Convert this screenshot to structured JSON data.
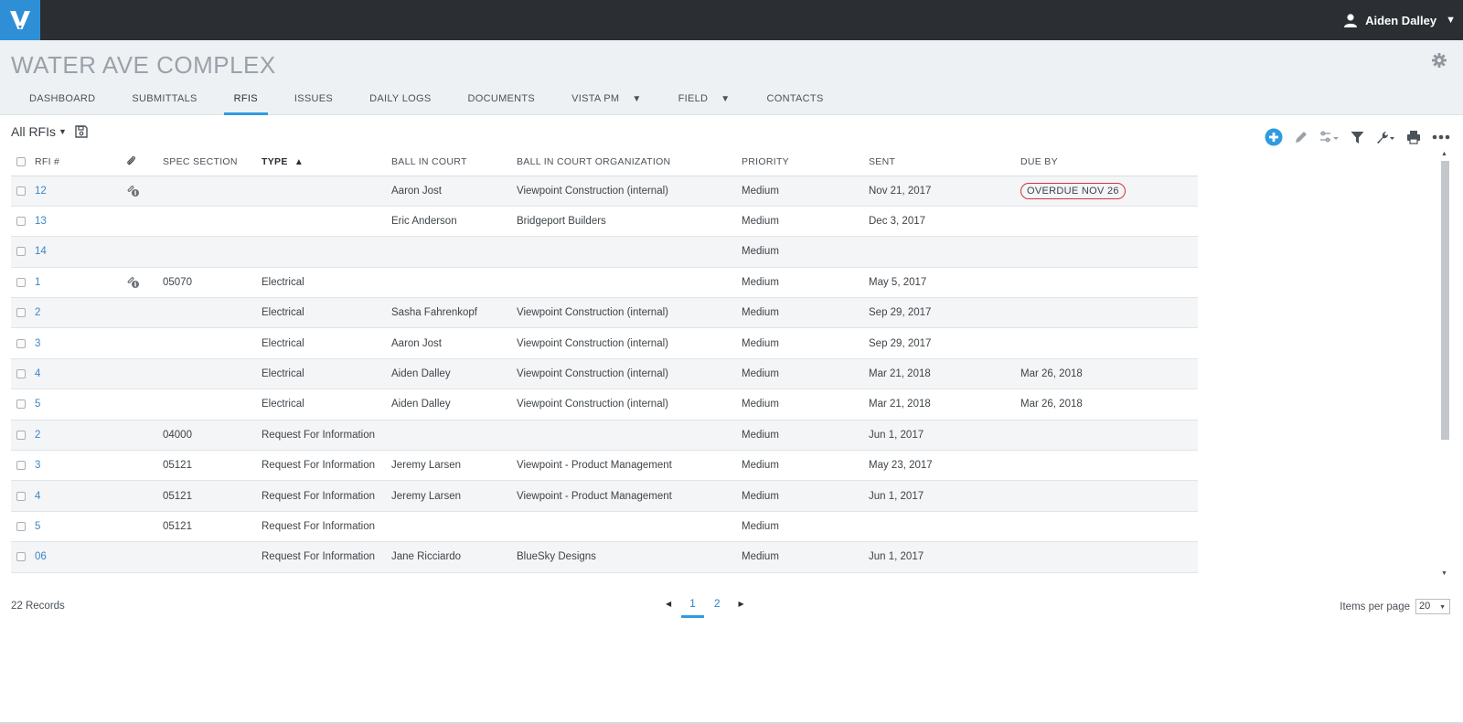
{
  "user": {
    "name": "Aiden Dalley"
  },
  "project": {
    "title": "WATER AVE COMPLEX"
  },
  "nav": [
    {
      "label": "DASHBOARD",
      "dropdown": false
    },
    {
      "label": "SUBMITTALS",
      "dropdown": false
    },
    {
      "label": "RFIS",
      "dropdown": false,
      "active": true
    },
    {
      "label": "ISSUES",
      "dropdown": false
    },
    {
      "label": "DAILY LOGS",
      "dropdown": false
    },
    {
      "label": "DOCUMENTS",
      "dropdown": false
    },
    {
      "label": "VISTA PM",
      "dropdown": true
    },
    {
      "label": "FIELD",
      "dropdown": true
    },
    {
      "label": "CONTACTS",
      "dropdown": false
    }
  ],
  "view": {
    "label": "All RFIs"
  },
  "colors": {
    "accent": "#2f9be0",
    "overdue": "#d9303b",
    "logo": "#2f8fd6"
  },
  "table": {
    "headers": {
      "rfi": "RFI #",
      "spec": "SPEC SECTION",
      "type": "TYPE",
      "bic": "BALL IN COURT",
      "bic_org": "BALL IN COURT ORGANIZATION",
      "priority": "PRIORITY",
      "sent": "SENT",
      "due": "DUE BY"
    },
    "sort_indicator": "▲",
    "rows": [
      {
        "rfi": "12",
        "attach": true,
        "spec": "",
        "type": "",
        "bic": "Aaron Jost",
        "bic_org": "Viewpoint Construction (internal)",
        "priority": "Medium",
        "sent": "Nov 21, 2017",
        "due": "OVERDUE NOV 26",
        "overdue": true
      },
      {
        "rfi": "13",
        "attach": false,
        "spec": "",
        "type": "",
        "bic": "Eric Anderson",
        "bic_org": "Bridgeport Builders",
        "priority": "Medium",
        "sent": "Dec 3, 2017",
        "due": ""
      },
      {
        "rfi": "14",
        "attach": false,
        "spec": "",
        "type": "",
        "bic": "",
        "bic_org": "",
        "priority": "Medium",
        "sent": "",
        "due": ""
      },
      {
        "rfi": "1",
        "attach": true,
        "spec": "05070",
        "type": "Electrical",
        "bic": "",
        "bic_org": "",
        "priority": "Medium",
        "sent": "May 5, 2017",
        "due": ""
      },
      {
        "rfi": "2",
        "attach": false,
        "spec": "",
        "type": "Electrical",
        "bic": "Sasha Fahrenkopf",
        "bic_org": "Viewpoint Construction (internal)",
        "priority": "Medium",
        "sent": "Sep 29, 2017",
        "due": ""
      },
      {
        "rfi": "3",
        "attach": false,
        "spec": "",
        "type": "Electrical",
        "bic": "Aaron Jost",
        "bic_org": "Viewpoint Construction (internal)",
        "priority": "Medium",
        "sent": "Sep 29, 2017",
        "due": ""
      },
      {
        "rfi": "4",
        "attach": false,
        "spec": "",
        "type": "Electrical",
        "bic": "Aiden Dalley",
        "bic_org": "Viewpoint Construction (internal)",
        "priority": "Medium",
        "sent": "Mar 21, 2018",
        "due": "Mar 26, 2018"
      },
      {
        "rfi": "5",
        "attach": false,
        "spec": "",
        "type": "Electrical",
        "bic": "Aiden Dalley",
        "bic_org": "Viewpoint Construction (internal)",
        "priority": "Medium",
        "sent": "Mar 21, 2018",
        "due": "Mar 26, 2018"
      },
      {
        "rfi": "2",
        "attach": false,
        "spec": "04000",
        "type": "Request For Information",
        "bic": "",
        "bic_org": "",
        "priority": "Medium",
        "sent": "Jun 1, 2017",
        "due": ""
      },
      {
        "rfi": "3",
        "attach": false,
        "spec": "05121",
        "type": "Request For Information",
        "bic": "Jeremy Larsen",
        "bic_org": "Viewpoint - Product Management",
        "priority": "Medium",
        "sent": "May 23, 2017",
        "due": ""
      },
      {
        "rfi": "4",
        "attach": false,
        "spec": "05121",
        "type": "Request For Information",
        "bic": "Jeremy Larsen",
        "bic_org": "Viewpoint - Product Management",
        "priority": "Medium",
        "sent": "Jun 1, 2017",
        "due": ""
      },
      {
        "rfi": "5",
        "attach": false,
        "spec": "05121",
        "type": "Request For Information",
        "bic": "",
        "bic_org": "",
        "priority": "Medium",
        "sent": "",
        "due": ""
      },
      {
        "rfi": "06",
        "attach": false,
        "spec": "",
        "type": "Request For Information",
        "bic": "Jane Ricciardo",
        "bic_org": "BlueSky Designs",
        "priority": "Medium",
        "sent": "Jun 1, 2017",
        "due": ""
      }
    ]
  },
  "footer": {
    "records": "22 Records",
    "pages": [
      "1",
      "2"
    ],
    "current_page": "1",
    "items_per_page_label": "Items per page",
    "items_per_page_value": "20"
  }
}
